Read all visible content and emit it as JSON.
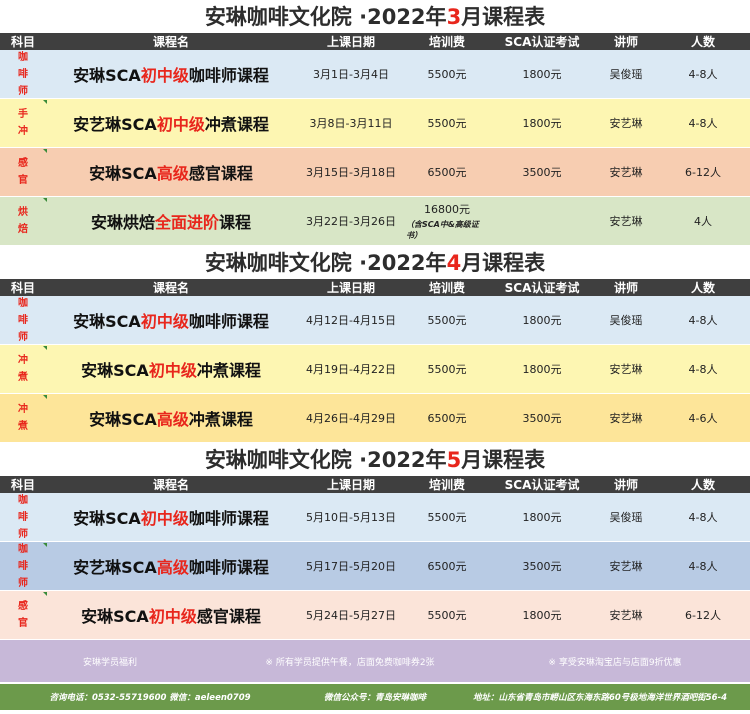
{
  "headers": [
    "科目",
    "课程名",
    "上课日期",
    "培训费",
    "SCA认证考试",
    "讲师",
    "人数"
  ],
  "sections": [
    {
      "title_pre": "安琳咖啡文化院  ·2022年",
      "title_month": "3",
      "title_post": "月课程表",
      "rows": [
        {
          "subject": [
            "咖",
            "啡",
            "师"
          ],
          "name_pre": "安琳SCA",
          "name_red": "初中级",
          "name_post": "咖啡师课程",
          "date": "3月1日-3月4日",
          "fee": "5500元",
          "fee_note": "",
          "exam": "1800元",
          "teacher": "吴俊瑶",
          "size": "4-8人",
          "bg": "bg-blue"
        },
        {
          "subject": [
            "手",
            "冲"
          ],
          "name_pre": "安艺琳SCA",
          "name_red": "初中级",
          "name_post": "冲煮课程",
          "date": "3月8日-3月11日",
          "fee": "5500元",
          "fee_note": "",
          "exam": "1800元",
          "teacher": "安艺琳",
          "size": "4-8人",
          "bg": "bg-yellow"
        },
        {
          "subject": [
            "感",
            "官"
          ],
          "name_pre": "安琳SCA",
          "name_red": "高级",
          "name_post": "感官课程",
          "date": "3月15日-3月18日",
          "fee": "6500元",
          "fee_note": "",
          "exam": "3500元",
          "teacher": "安艺琳",
          "size": "6-12人",
          "bg": "bg-peach"
        },
        {
          "subject": [
            "烘",
            "焙"
          ],
          "name_pre": "安琳烘焙",
          "name_red": "全面进阶",
          "name_post": "课程",
          "date": "3月22日-3月26日",
          "fee": "16800元",
          "fee_note": "（含SCA中&高级证书）",
          "exam": "",
          "teacher": "安艺琳",
          "size": "4人",
          "bg": "bg-green"
        }
      ]
    },
    {
      "title_pre": "安琳咖啡文化院  ·2022年",
      "title_month": "4",
      "title_post": "月课程表",
      "rows": [
        {
          "subject": [
            "咖",
            "啡",
            "师"
          ],
          "name_pre": "安琳SCA",
          "name_red": "初中级",
          "name_post": "咖啡师课程",
          "date": "4月12日-4月15日",
          "fee": "5500元",
          "fee_note": "",
          "exam": "1800元",
          "teacher": "吴俊瑶",
          "size": "4-8人",
          "bg": "bg-blue"
        },
        {
          "subject": [
            "冲",
            "煮"
          ],
          "name_pre": "安琳SCA",
          "name_red": "初中级",
          "name_post": "冲煮课程",
          "date": "4月19日-4月22日",
          "fee": "5500元",
          "fee_note": "",
          "exam": "1800元",
          "teacher": "安艺琳",
          "size": "4-8人",
          "bg": "bg-yellow"
        },
        {
          "subject": [
            "冲",
            "煮"
          ],
          "name_pre": "安琳SCA",
          "name_red": "高级",
          "name_post": "冲煮课程",
          "date": "4月26日-4月29日",
          "fee": "6500元",
          "fee_note": "",
          "exam": "3500元",
          "teacher": "安艺琳",
          "size": "4-6人",
          "bg": "bg-gold"
        }
      ]
    },
    {
      "title_pre": "安琳咖啡文化院  ·2022年",
      "title_month": "5",
      "title_post": "月课程表",
      "rows": [
        {
          "subject": [
            "咖",
            "啡",
            "师"
          ],
          "name_pre": "安琳SCA",
          "name_red": "初中级",
          "name_post": "咖啡师课程",
          "date": "5月10日-5月13日",
          "fee": "5500元",
          "fee_note": "",
          "exam": "1800元",
          "teacher": "吴俊瑶",
          "size": "4-8人",
          "bg": "bg-blue"
        },
        {
          "subject": [
            "咖",
            "啡",
            "师"
          ],
          "name_pre": "安艺琳SCA",
          "name_red": "高级",
          "name_post": "咖啡师课程",
          "date": "5月17日-5月20日",
          "fee": "6500元",
          "fee_note": "",
          "exam": "3500元",
          "teacher": "安艺琳",
          "size": "4-8人",
          "bg": "bg-steel"
        },
        {
          "subject": [
            "感",
            "官"
          ],
          "name_pre": "安琳SCA",
          "name_red": "初中级",
          "name_post": "感官课程",
          "date": "5月24日-5月27日",
          "fee": "5500元",
          "fee_note": "",
          "exam": "1800元",
          "teacher": "安艺琳",
          "size": "6-12人",
          "bg": "bg-pink"
        }
      ]
    }
  ],
  "benefits": {
    "label": "安琳学员福利",
    "item1": "※ 所有学员提供午餐，店面免费咖啡券2张",
    "item2": "※ 享受安琳淘宝店与店面9折优惠"
  },
  "footer": {
    "phone": "咨询电话：0532-55719600  微信：aeleen0709",
    "wechat": "微信公众号：青岛安琳咖啡",
    "address": "地址：山东省青岛市崂山区东海东路60号极地海洋世界酒吧街56-4"
  }
}
